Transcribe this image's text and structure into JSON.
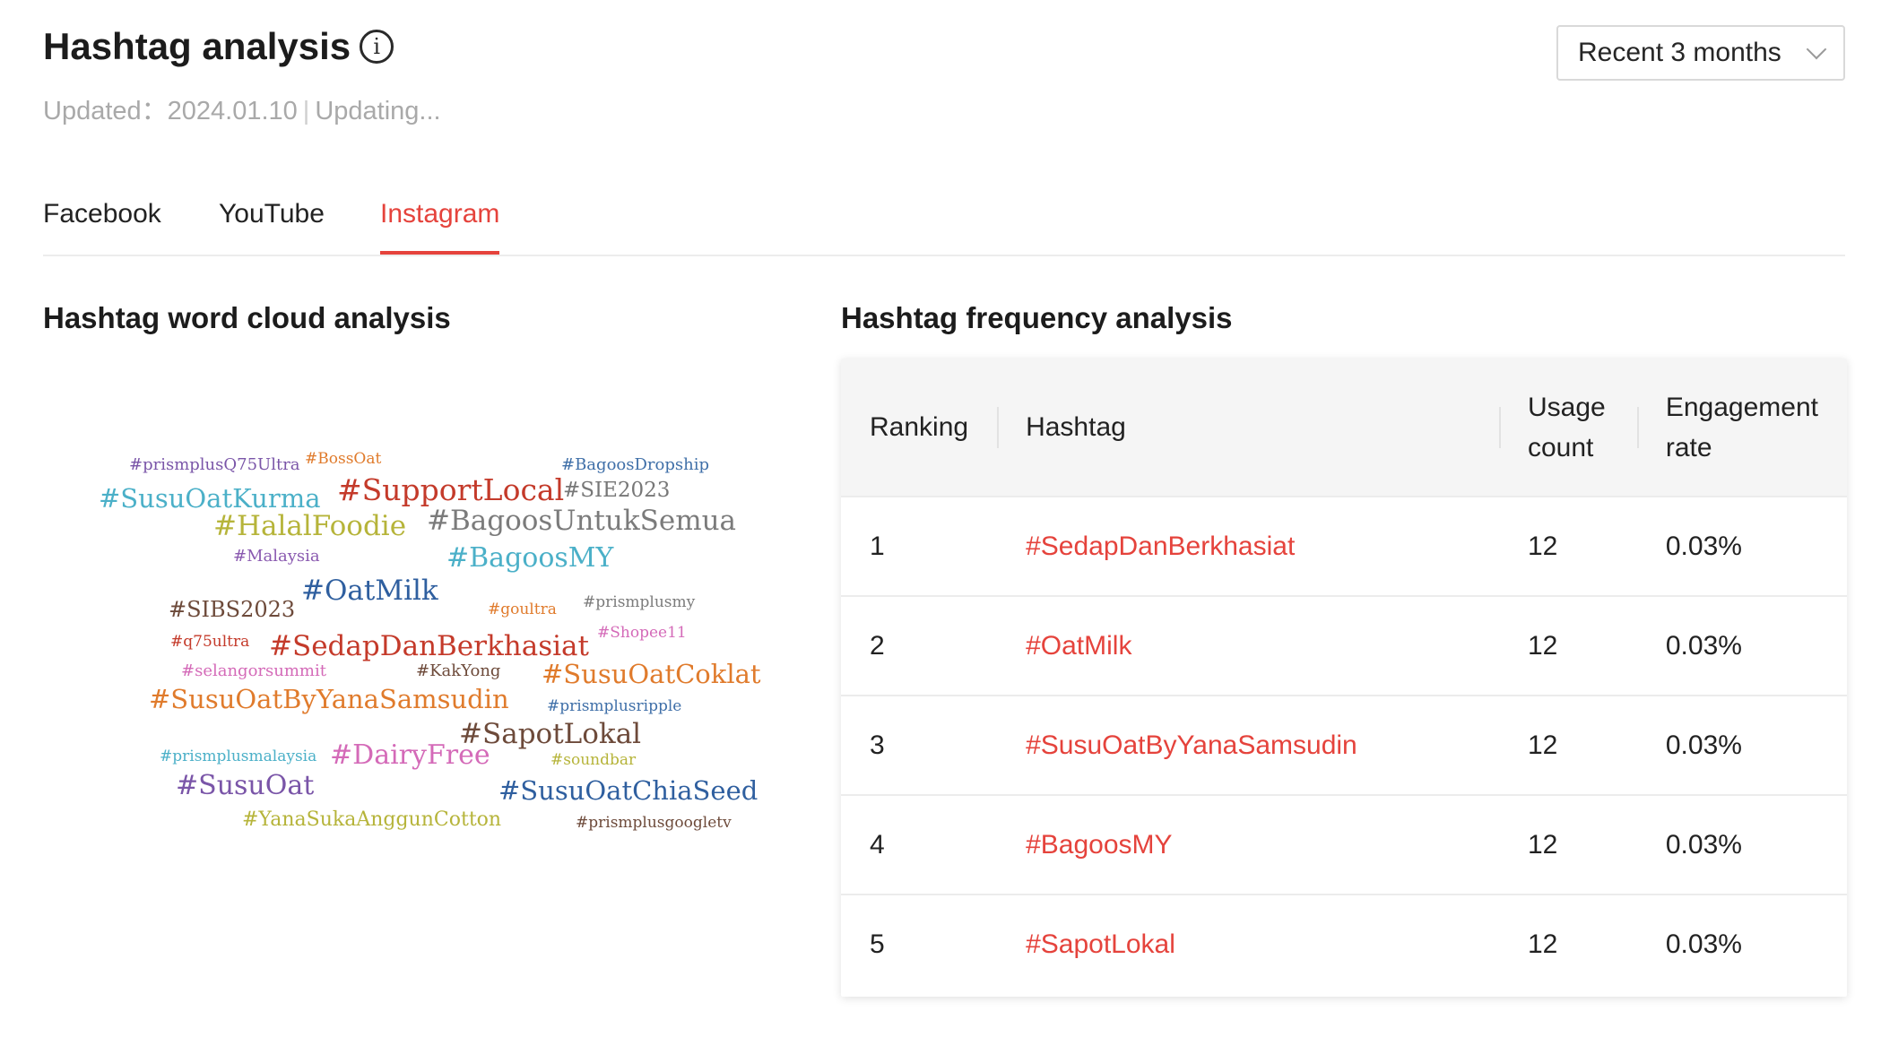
{
  "header": {
    "title": "Hashtag analysis",
    "updated_label": "Updated：2024.01.10",
    "separator": "|",
    "status": "Updating..."
  },
  "period_select": {
    "value": "Recent 3 months"
  },
  "tabs": [
    {
      "label": "Facebook",
      "active": false
    },
    {
      "label": "YouTube",
      "active": false
    },
    {
      "label": "Instagram",
      "active": true
    }
  ],
  "word_cloud": {
    "title": "Hashtag word cloud analysis",
    "words": [
      {
        "text": "#prismplusQ75Ultra",
        "color": "#7a55a8"
      },
      {
        "text": "#BossOat",
        "color": "#e07b2c"
      },
      {
        "text": "#BagoosDropship",
        "color": "#3f6fa8"
      },
      {
        "text": "#SusuOatKurma",
        "color": "#4bb0c8"
      },
      {
        "text": "#SupportLocal",
        "color": "#c43a2a"
      },
      {
        "text": "#SIE2023",
        "color": "#777777"
      },
      {
        "text": "#HalalFoodie",
        "color": "#b6b43a"
      },
      {
        "text": "#BagoosUntukSemua",
        "color": "#7b7b7b"
      },
      {
        "text": "#Malaysia",
        "color": "#8a5ab0"
      },
      {
        "text": "#BagoosMY",
        "color": "#4bb0c8"
      },
      {
        "text": "#OatMilk",
        "color": "#2f5f9f"
      },
      {
        "text": "#SIBS2023",
        "color": "#6d4a3a"
      },
      {
        "text": "#goultra",
        "color": "#e07b2c"
      },
      {
        "text": "#prismplusmy",
        "color": "#7b7b7b"
      },
      {
        "text": "#Shopee11",
        "color": "#d46ab8"
      },
      {
        "text": "#q75ultra",
        "color": "#c43a2a"
      },
      {
        "text": "#SedapDanBerkhasiat",
        "color": "#c43a2a"
      },
      {
        "text": "#selangorsummit",
        "color": "#d46ab8"
      },
      {
        "text": "#KakYong",
        "color": "#6d4a3a"
      },
      {
        "text": "#SusuOatCoklat",
        "color": "#e07b2c"
      },
      {
        "text": "#SusuOatByYanaSamsudin",
        "color": "#e07b2c"
      },
      {
        "text": "#prismplusripple",
        "color": "#3f6fa8"
      },
      {
        "text": "#SapotLokal",
        "color": "#6d4a3a"
      },
      {
        "text": "#prismplusmalaysia",
        "color": "#4bb0c8"
      },
      {
        "text": "#DairyFree",
        "color": "#d46ab8"
      },
      {
        "text": "#soundbar",
        "color": "#b6b43a"
      },
      {
        "text": "#SusuOat",
        "color": "#7a55a8"
      },
      {
        "text": "#SusuOatChiaSeed",
        "color": "#2f5f9f"
      },
      {
        "text": "#YanaSukaAnggunCotton",
        "color": "#b6b43a"
      },
      {
        "text": "#prismplusgoogletv",
        "color": "#6d4a3a"
      }
    ]
  },
  "frequency": {
    "title": "Hashtag frequency analysis",
    "columns": [
      "Ranking",
      "Hashtag",
      "Usage count",
      "Engagement rate"
    ],
    "rows": [
      {
        "rank": "1",
        "hashtag": "#SedapDanBerkhasiat",
        "usage": "12",
        "engagement": "0.03%"
      },
      {
        "rank": "2",
        "hashtag": "#OatMilk",
        "usage": "12",
        "engagement": "0.03%"
      },
      {
        "rank": "3",
        "hashtag": "#SusuOatByYanaSamsudin",
        "usage": "12",
        "engagement": "0.03%"
      },
      {
        "rank": "4",
        "hashtag": "#BagoosMY",
        "usage": "12",
        "engagement": "0.03%"
      },
      {
        "rank": "5",
        "hashtag": "#SapotLokal",
        "usage": "12",
        "engagement": "0.03%"
      }
    ]
  }
}
